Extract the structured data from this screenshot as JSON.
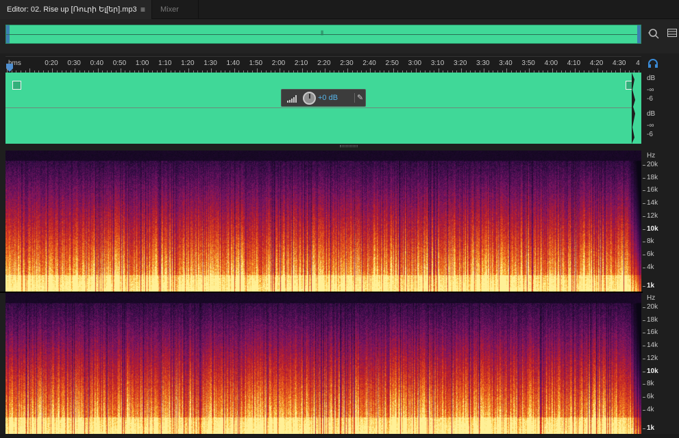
{
  "tabs": {
    "editor_label": "Editor: 02. Rise up [Ռուրի Ել[եր].mp3",
    "editor_menu_icon": "hamburger-menu-icon",
    "mixer_label": "Mixer"
  },
  "ruler": {
    "unit_label": "hms",
    "end_label": "4",
    "time_labels": [
      "0:20",
      "0:30",
      "0:40",
      "0:50",
      "1:00",
      "1:10",
      "1:20",
      "1:30",
      "1:40",
      "1:50",
      "2:00",
      "2:10",
      "2:20",
      "2:30",
      "2:40",
      "2:50",
      "3:00",
      "3:10",
      "3:20",
      "3:30",
      "3:40",
      "3:50",
      "4:00",
      "4:10",
      "4:20",
      "4:30"
    ]
  },
  "hud": {
    "volume": "+0 dB",
    "pin_icon": "pin-icon",
    "meter_icon": "level-bars-icon"
  },
  "db_scale": {
    "channel1": [
      "dB",
      "-∞",
      "-6"
    ],
    "channel2": [
      "dB",
      "-∞",
      "-6"
    ]
  },
  "hz_scale": {
    "unit": "Hz",
    "labels": [
      "20k",
      "18k",
      "16k",
      "14k",
      "12k",
      "10k",
      "8k",
      "6k",
      "4k",
      "1k"
    ]
  },
  "colors": {
    "waveform": "#40d898",
    "accent": "#56b4e9",
    "background": "#1e1e1e"
  },
  "icons": {
    "zoom": "zoom-icon",
    "panel": "panel-options-icon",
    "loop": "headphones-icon",
    "playhead": "playhead-marker-icon"
  }
}
